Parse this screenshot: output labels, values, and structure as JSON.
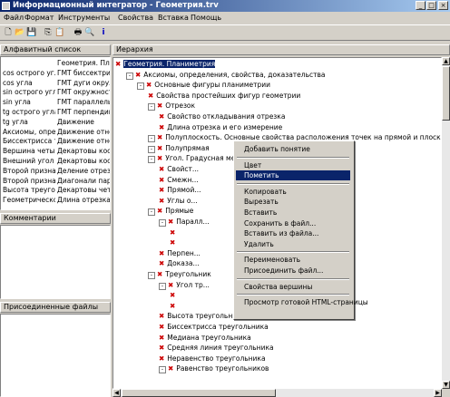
{
  "window": {
    "title": "Информационный интегратор - Геометрия.trv"
  },
  "menu": [
    "Файл",
    "Формат",
    "Инструменты",
    "Свойства",
    "Вставка",
    "Помощь"
  ],
  "toolbar": [
    "new-icon",
    "open-icon",
    "save-icon",
    "copy-icon",
    "paste-icon",
    "print-icon",
    "preview-icon",
    "info-icon"
  ],
  "left": {
    "alpha_header": "Алфавитный список",
    "alpha_items": [
      [
        "",
        "Геометрия. Пла..."
      ],
      [
        "cos острого угла",
        "ГМТ биссектрисы"
      ],
      [
        "cos угла",
        "ГМТ дуги окруж..."
      ],
      [
        "sin острого угла",
        "ГМТ окружности"
      ],
      [
        "sin угла",
        "ГМТ параллель..."
      ],
      [
        "tg острого угла",
        "ГМТ перпендик..."
      ],
      [
        "tg угла",
        "Движение"
      ],
      [
        "Аксиомы, опред...",
        "Движение отно..."
      ],
      [
        "Биссектрисса т...",
        "Движение отно..."
      ],
      [
        "Вершина четыр...",
        "Декартовы кос..."
      ],
      [
        "Внешний угол т...",
        "Декартовы кос..."
      ],
      [
        "Второй признак...",
        "Деление отрезк..."
      ],
      [
        "Второй признак...",
        "Диагонали пара..."
      ],
      [
        "Высота треугол...",
        "Декартовы четы..."
      ],
      [
        "Геометрическо...",
        "Длина отрезка ..."
      ]
    ],
    "comments_header": "Комментарии",
    "files_header": "Присоединенные файлы"
  },
  "right": {
    "header": "Иерархия",
    "tree": [
      {
        "l": "Геометрия. Планиметрия",
        "d": 0,
        "pm": "",
        "sel": true
      },
      {
        "l": "Аксиомы, определения, свойства, доказательства",
        "d": 1,
        "pm": "-"
      },
      {
        "l": "Основные фигуры планиметрии",
        "d": 2,
        "pm": "-"
      },
      {
        "l": "Свойства простейших фигур геометрии",
        "d": 3,
        "pm": ""
      },
      {
        "l": "Отрезок",
        "d": 3,
        "pm": "-"
      },
      {
        "l": "Свойство откладывания отрезка",
        "d": 4,
        "pm": ""
      },
      {
        "l": "Длина отрезка и его измерение",
        "d": 4,
        "pm": ""
      },
      {
        "l": "Полуплоскость. Основные свойства расположения точек на прямой и плоскости",
        "d": 3,
        "pm": "-"
      },
      {
        "l": "Полупрямая",
        "d": 3,
        "pm": "-"
      },
      {
        "l": "Угол. Градусная мера",
        "d": 3,
        "pm": "-"
      },
      {
        "l": "Свойст...",
        "d": 4,
        "pm": ""
      },
      {
        "l": "Смежн...",
        "d": 4,
        "pm": ""
      },
      {
        "l": "Прямой...",
        "d": 4,
        "pm": ""
      },
      {
        "l": "Углы о...",
        "d": 4,
        "pm": ""
      },
      {
        "l": "Прямые",
        "d": 3,
        "pm": "-"
      },
      {
        "l": "Паралл...",
        "d": 4,
        "pm": "-"
      },
      {
        "l": "",
        "d": 5,
        "pm": ""
      },
      {
        "l": "",
        "d": 5,
        "pm": ""
      },
      {
        "l": "Перпен...",
        "d": 4,
        "pm": ""
      },
      {
        "l": "Доказа...",
        "d": 4,
        "pm": ""
      },
      {
        "l": "Треугольник",
        "d": 3,
        "pm": "-"
      },
      {
        "l": "Угол тр...",
        "d": 4,
        "pm": "-"
      },
      {
        "l": "",
        "d": 5,
        "pm": ""
      },
      {
        "l": "",
        "d": 5,
        "pm": ""
      },
      {
        "l": "Высота треугольника",
        "d": 4,
        "pm": ""
      },
      {
        "l": "Биссектрисса треугольника",
        "d": 4,
        "pm": ""
      },
      {
        "l": "Медиана треугольника",
        "d": 4,
        "pm": ""
      },
      {
        "l": "Средняя линия треугольника",
        "d": 4,
        "pm": ""
      },
      {
        "l": "Неравенство треугольника",
        "d": 4,
        "pm": ""
      },
      {
        "l": "Равенство треугольников",
        "d": 4,
        "pm": "-"
      }
    ]
  },
  "context_menu": [
    {
      "label": "Добавить понятие"
    },
    {
      "sep": true
    },
    {
      "label": "Цвет"
    },
    {
      "label": "Пометить",
      "hl": true
    },
    {
      "sep": true
    },
    {
      "label": "Копировать"
    },
    {
      "label": "Вырезать"
    },
    {
      "label": "Вставить"
    },
    {
      "label": "Сохранить в файл..."
    },
    {
      "label": "Вставить из файла..."
    },
    {
      "label": "Удалить"
    },
    {
      "sep": true
    },
    {
      "label": "Переименовать"
    },
    {
      "label": "Присоединить файл..."
    },
    {
      "sep": true
    },
    {
      "label": "Свойства вершины"
    },
    {
      "sep": true
    },
    {
      "label": "Просмотр готовой HTML-страницы"
    }
  ]
}
